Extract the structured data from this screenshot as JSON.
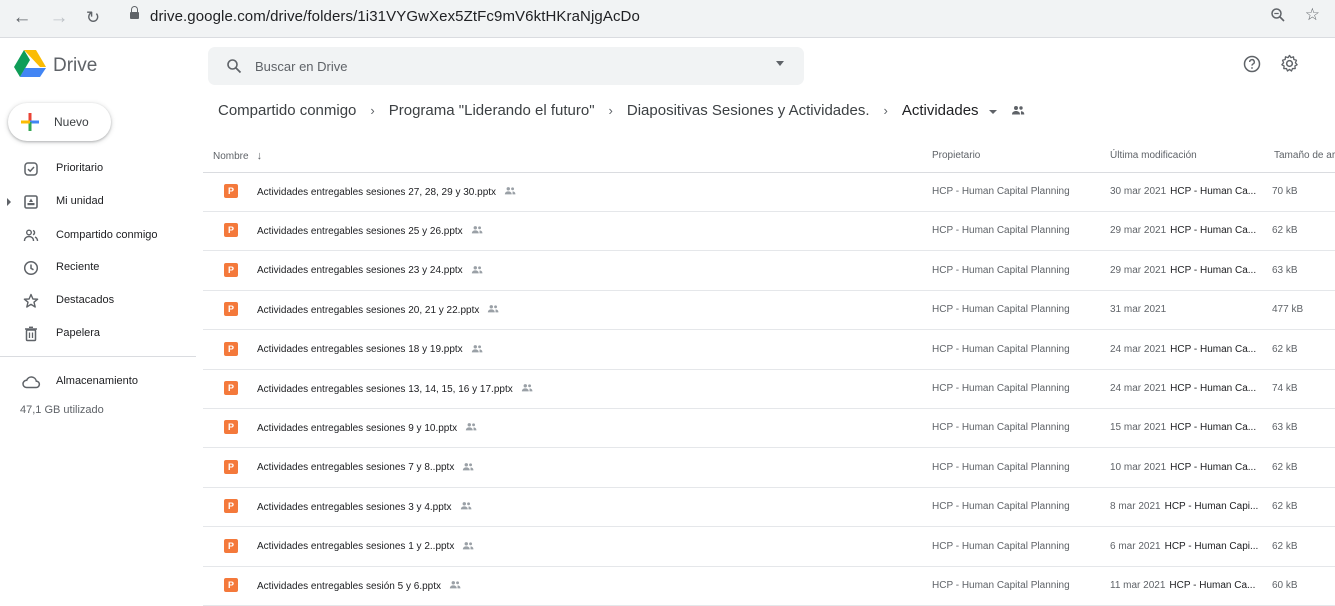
{
  "browser": {
    "url": "drive.google.com/drive/folders/1i31VYGwXex5ZtFc9mV6ktHKraNjgAcDo",
    "icons": [
      "back-arrow-icon",
      "forward-arrow-icon",
      "reload-icon",
      "lock-icon",
      "zoom-icon",
      "star-icon"
    ]
  },
  "header": {
    "app_name": "Drive",
    "search_placeholder": "Buscar en Drive"
  },
  "sidebar": {
    "new_label": "Nuevo",
    "items": [
      {
        "label": "Prioritario",
        "icon": "check-circle-icon"
      },
      {
        "label": "Mi unidad",
        "icon": "drive-icon"
      },
      {
        "label": "Compartido conmigo",
        "icon": "people-icon"
      },
      {
        "label": "Reciente",
        "icon": "clock-icon"
      },
      {
        "label": "Destacados",
        "icon": "star-outline-icon"
      },
      {
        "label": "Papelera",
        "icon": "trash-icon"
      }
    ],
    "storage_label": "Almacenamiento",
    "storage_used": "47,1 GB utilizado"
  },
  "breadcrumb": {
    "items": [
      "Compartido conmigo",
      "Programa \"Liderando el futuro\"",
      "Diapositivas Sesiones y Actividades."
    ],
    "current": "Actividades"
  },
  "table": {
    "columns": {
      "name": "Nombre",
      "owner": "Propietario",
      "modified": "Última modificación",
      "size": "Tamaño de archivo"
    },
    "rows": [
      {
        "name": "Actividades entregables sesiones 27, 28, 29 y 30.pptx",
        "owner": "HCP - Human Capital Planning",
        "date": "30 mar 2021",
        "by": "HCP - Human Ca...",
        "size": "70 kB"
      },
      {
        "name": "Actividades entregables sesiones 25 y 26.pptx",
        "owner": "HCP - Human Capital Planning",
        "date": "29 mar 2021",
        "by": "HCP - Human Ca...",
        "size": "62 kB"
      },
      {
        "name": "Actividades entregables sesiones 23 y 24.pptx",
        "owner": "HCP - Human Capital Planning",
        "date": "29 mar 2021",
        "by": "HCP - Human Ca...",
        "size": "63 kB"
      },
      {
        "name": "Actividades entregables sesiones 20, 21 y 22.pptx",
        "owner": "HCP - Human Capital Planning",
        "date": "31 mar 2021",
        "by": "",
        "size": "477 kB"
      },
      {
        "name": "Actividades entregables sesiones 18 y 19.pptx",
        "owner": "HCP - Human Capital Planning",
        "date": "24 mar 2021",
        "by": "HCP - Human Ca...",
        "size": "62 kB"
      },
      {
        "name": "Actividades entregables sesiones 13, 14, 15, 16 y 17.pptx",
        "owner": "HCP - Human Capital Planning",
        "date": "24 mar 2021",
        "by": "HCP - Human Ca...",
        "size": "74 kB"
      },
      {
        "name": "Actividades entregables sesiones 9 y 10.pptx",
        "owner": "HCP - Human Capital Planning",
        "date": "15 mar 2021",
        "by": "HCP - Human Ca...",
        "size": "63 kB"
      },
      {
        "name": "Actividades entregables sesiones 7 y 8..pptx",
        "owner": "HCP - Human Capital Planning",
        "date": "10 mar 2021",
        "by": "HCP - Human Ca...",
        "size": "62 kB"
      },
      {
        "name": "Actividades entregables sesiones 3 y 4.pptx",
        "owner": "HCP - Human Capital Planning",
        "date": "8 mar 2021",
        "by": "HCP - Human Capi...",
        "size": "62 kB"
      },
      {
        "name": "Actividades entregables sesiones 1 y 2..pptx",
        "owner": "HCP - Human Capital Planning",
        "date": "6 mar 2021",
        "by": "HCP - Human Capi...",
        "size": "62 kB"
      },
      {
        "name": "Actividades entregables sesión 5 y 6.pptx",
        "owner": "HCP - Human Capital Planning",
        "date": "11 mar 2021",
        "by": "HCP - Human Ca...",
        "size": "60 kB"
      }
    ]
  },
  "colors": {
    "ppt_orange": "#f4793b",
    "text": "#202124",
    "muted": "#5f6368",
    "divider": "#dadce0"
  }
}
